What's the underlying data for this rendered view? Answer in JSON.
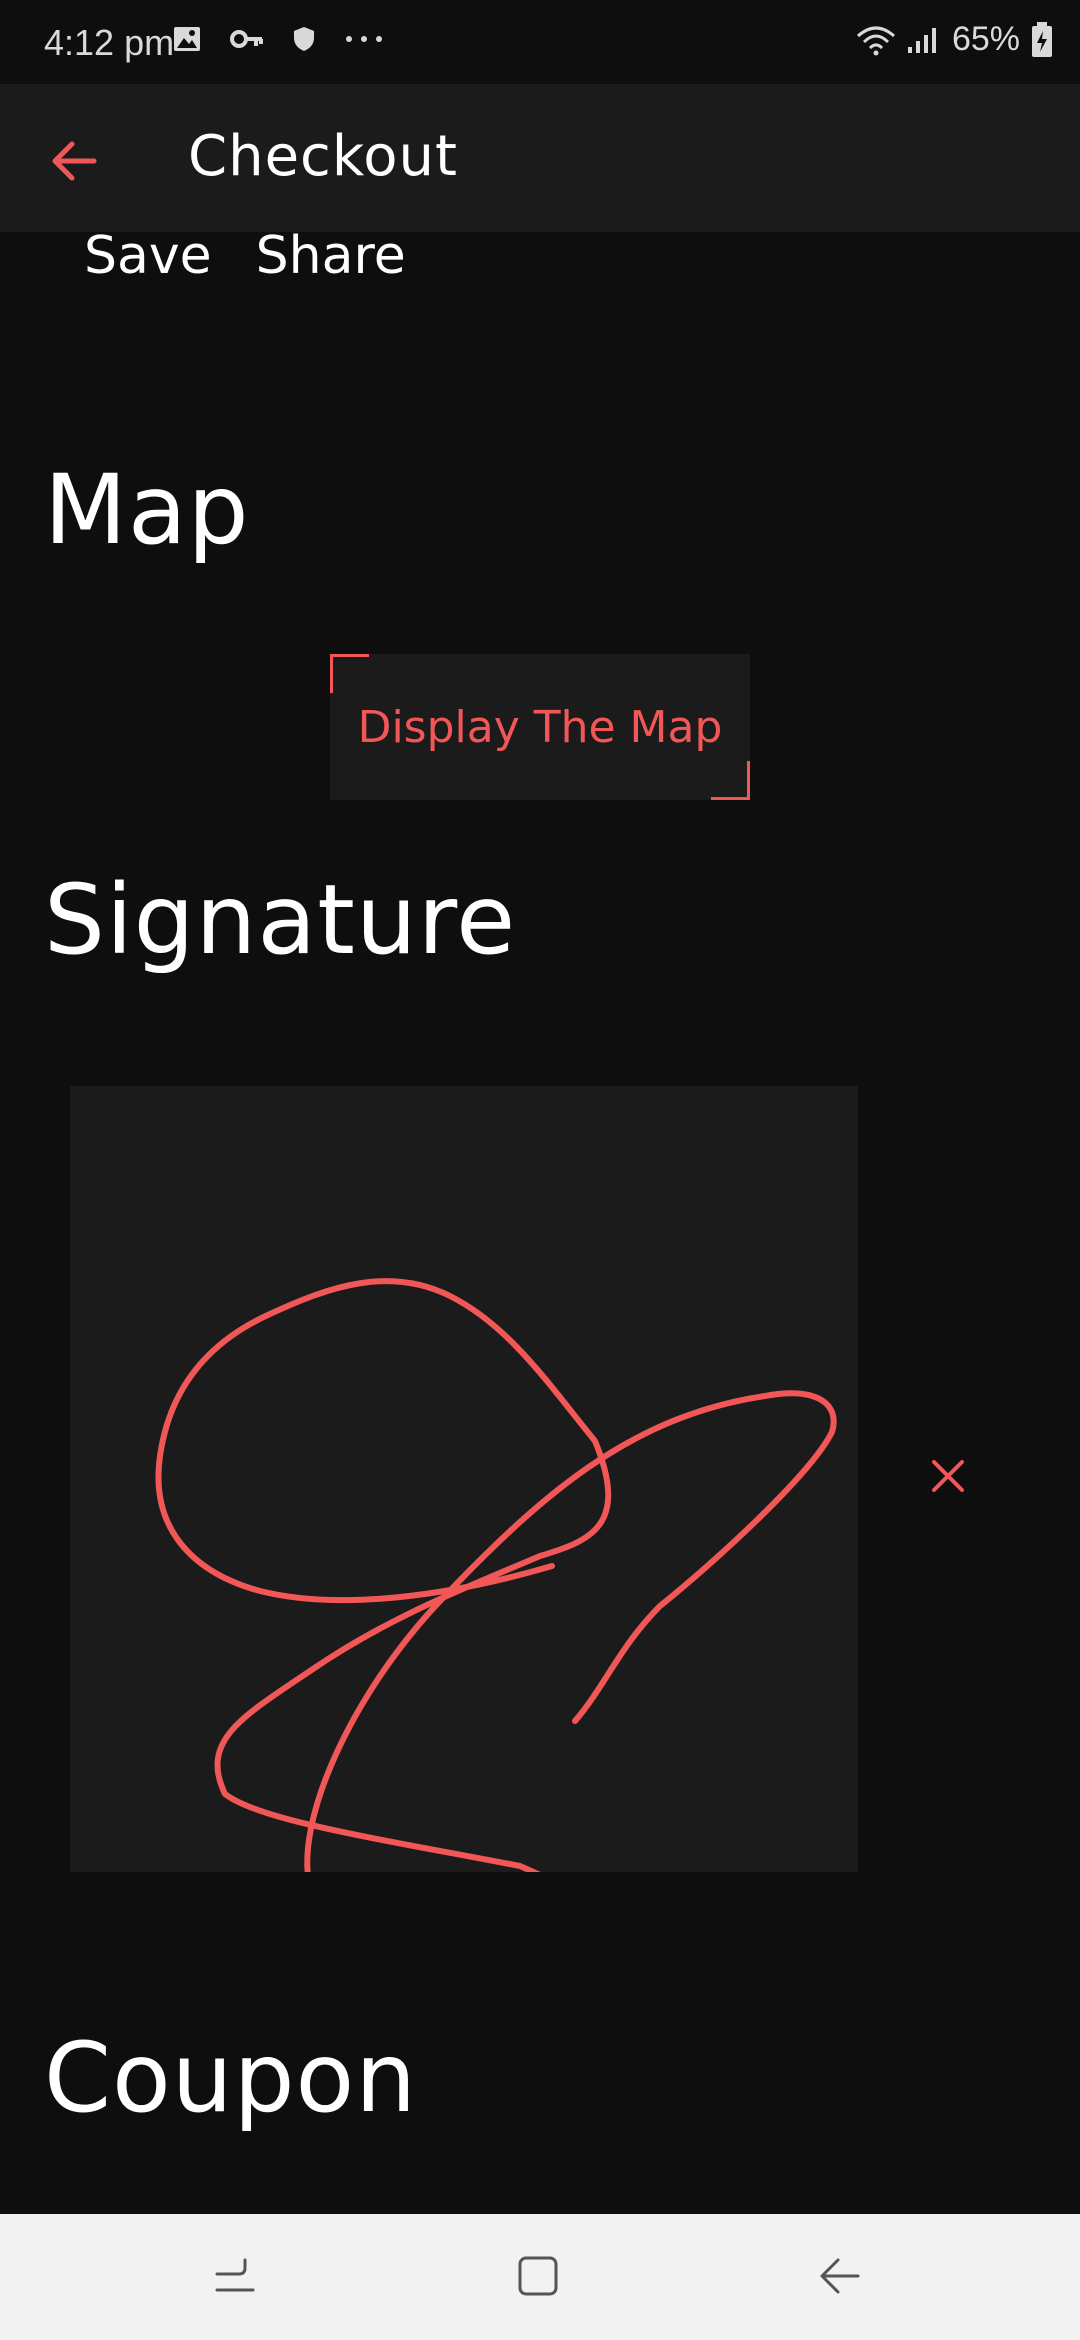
{
  "status_bar": {
    "time": "4:12 pm",
    "battery_percent": "65%",
    "icons": [
      "image-icon",
      "key-icon",
      "shield-icon",
      "more-dots-icon",
      "wifi-icon",
      "signal-icon",
      "battery-icon"
    ]
  },
  "app_bar": {
    "title": "Checkout",
    "back_icon": "arrow-left-icon",
    "accent_color": "#f25757"
  },
  "actions": {
    "save_label": "Save",
    "share_label": "Share"
  },
  "sections": {
    "map_title": "Map",
    "map_button_label": "Display The Map",
    "signature_title": "Signature",
    "coupon_title": "Coupon"
  },
  "signature": {
    "clear_icon": "close-icon"
  },
  "nav_bar": {
    "icons": [
      "recent-apps-icon",
      "home-icon",
      "back-icon"
    ]
  }
}
